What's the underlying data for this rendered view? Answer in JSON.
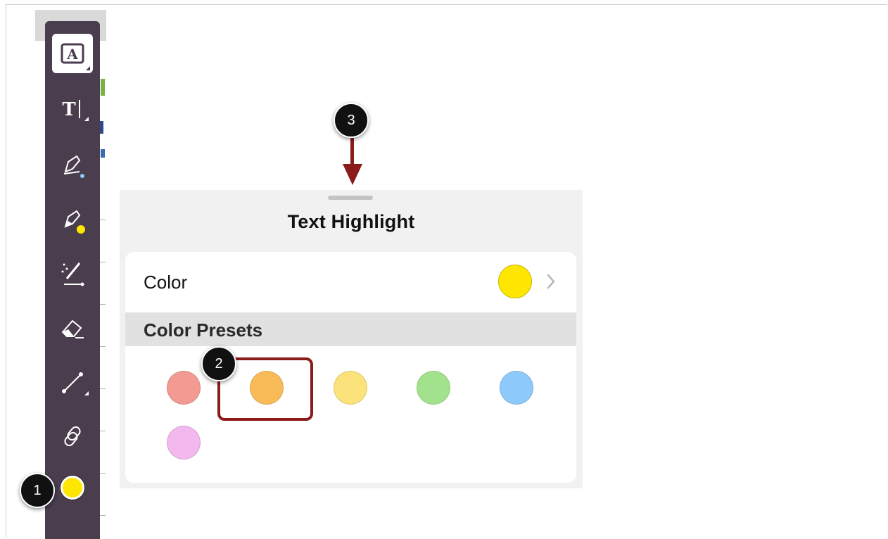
{
  "panel": {
    "title": "Text Highlight",
    "color_label": "Color",
    "current_color": "#ffe600",
    "presets_label": "Color Presets",
    "presets": [
      "#f39b93",
      "#f8bb57",
      "#fbe27a",
      "#a3e28d",
      "#8ec9fb",
      "#f3b8ee"
    ]
  },
  "toolbar": {
    "tools": [
      "text-annotation-icon",
      "text-insert-icon",
      "pen-icon",
      "highlighter-icon",
      "magic-wand-icon",
      "eraser-icon",
      "line-icon",
      "link-icon",
      "color-swatch"
    ],
    "active_color": "#ffe600"
  },
  "callouts": [
    "1",
    "2",
    "3"
  ],
  "colors": {
    "toolbar_bg": "#4a3d4e",
    "callout_red": "#8b1a1a"
  }
}
